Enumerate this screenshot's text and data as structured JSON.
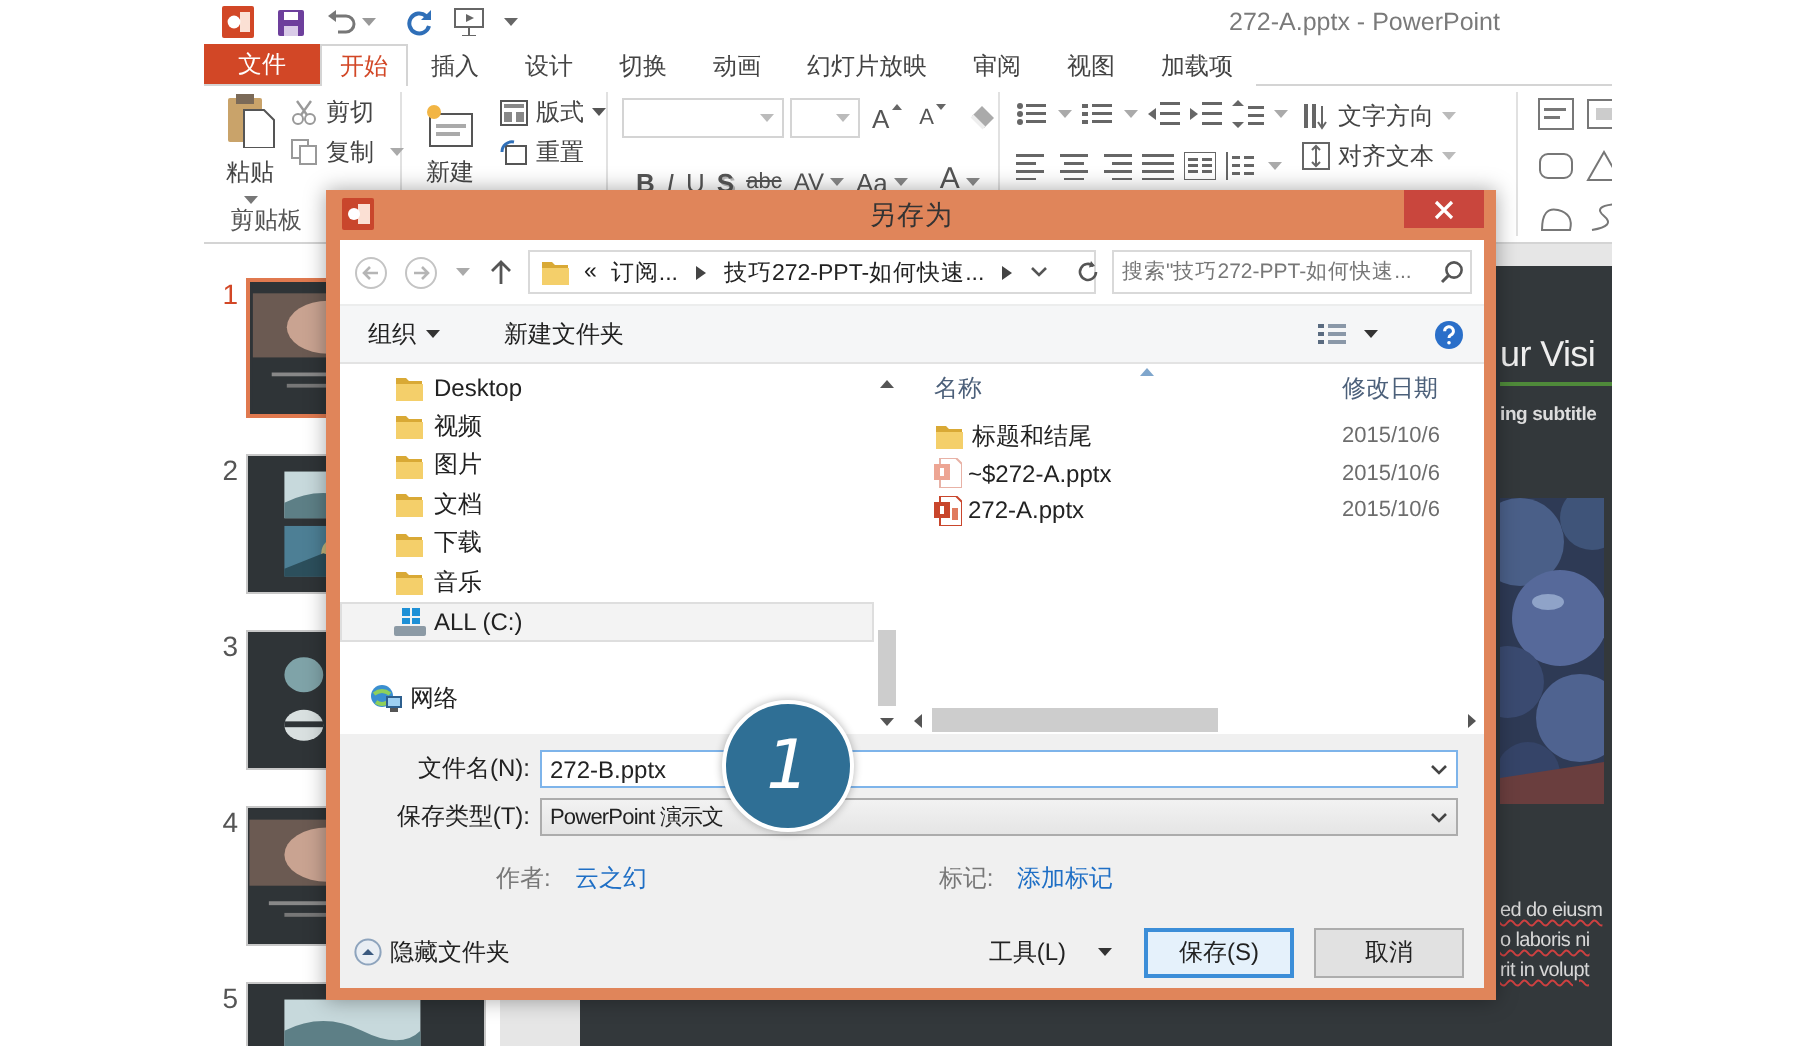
{
  "window": {
    "title": "272-A.pptx - PowerPoint"
  },
  "ribbon_tabs": [
    {
      "label": "文件",
      "kind": "file",
      "selected": false
    },
    {
      "label": "开始",
      "kind": "tab",
      "selected": true
    },
    {
      "label": "插入",
      "kind": "tab",
      "selected": false
    },
    {
      "label": "设计",
      "kind": "tab",
      "selected": false
    },
    {
      "label": "切换",
      "kind": "tab",
      "selected": false
    },
    {
      "label": "动画",
      "kind": "tab",
      "selected": false
    },
    {
      "label": "幻灯片放映",
      "kind": "tab",
      "selected": false
    },
    {
      "label": "审阅",
      "kind": "tab",
      "selected": false
    },
    {
      "label": "视图",
      "kind": "tab",
      "selected": false
    },
    {
      "label": "加载项",
      "kind": "tab",
      "selected": false
    }
  ],
  "ribbon": {
    "clipboard": {
      "paste": "粘贴",
      "cut": "剪切",
      "copy": "复制",
      "group_label": "剪贴板"
    },
    "slides": {
      "new_slide": "新建",
      "layout": "版式",
      "reset": "重置"
    },
    "font_size_buttons": [
      {
        "label": "A",
        "kind": "grow"
      },
      {
        "label": "A",
        "kind": "shrink"
      }
    ],
    "font_buttons": [
      {
        "label": "B",
        "kind": "bold"
      },
      {
        "label": "I",
        "kind": "italic"
      },
      {
        "label": "U",
        "kind": "underline"
      },
      {
        "label": "S",
        "kind": "shadow"
      },
      {
        "label": "abc",
        "kind": "strike"
      },
      {
        "label": "AV",
        "kind": "spacing"
      },
      {
        "label": "Aa",
        "kind": "case"
      },
      {
        "label": "A",
        "kind": "color"
      }
    ],
    "paragraph": {
      "text_direction": "文字方向",
      "align_text": "对齐文本"
    }
  },
  "slides": [
    {
      "number": "1",
      "selected": true
    },
    {
      "number": "2",
      "selected": false
    },
    {
      "number": "3",
      "selected": false
    },
    {
      "number": "4",
      "selected": false
    },
    {
      "number": "5",
      "selected": false
    }
  ],
  "slide": {
    "title": "ur Visi",
    "subtitle": "ing subtitle",
    "body_lines": [
      "ed do eiusm",
      "o laboris ni",
      "rit in volupt"
    ]
  },
  "dialog": {
    "title": "另存为",
    "address": {
      "overflow": "«",
      "segments": [
        "订阅...",
        "技巧272-PPT-如何快速..."
      ]
    },
    "search": {
      "placeholder": "搜索\"技巧272-PPT-如何快速..."
    },
    "toolbar": {
      "organize": "组织",
      "new_folder": "新建文件夹"
    },
    "nav_tree": [
      {
        "label": "Desktop",
        "kind": "folder",
        "selected": false
      },
      {
        "label": "视频",
        "kind": "folder",
        "selected": false
      },
      {
        "label": "图片",
        "kind": "folder",
        "selected": false
      },
      {
        "label": "文档",
        "kind": "folder",
        "selected": false
      },
      {
        "label": "下载",
        "kind": "folder",
        "selected": false
      },
      {
        "label": "音乐",
        "kind": "folder",
        "selected": false
      },
      {
        "label": "ALL (C:)",
        "kind": "drive",
        "selected": true
      },
      {
        "label": "网络",
        "kind": "network",
        "selected": false
      }
    ],
    "columns": [
      "名称",
      "修改日期"
    ],
    "files": [
      {
        "name": "标题和结尾",
        "kind": "folder",
        "date": "2015/10/6"
      },
      {
        "name": "~$272-A.pptx",
        "kind": "temp",
        "date": "2015/10/6"
      },
      {
        "name": "272-A.pptx",
        "kind": "pptx",
        "date": "2015/10/6"
      }
    ],
    "file_name": {
      "label": "文件名(N):",
      "value": "272-B.pptx"
    },
    "file_type": {
      "label": "保存类型(T):",
      "value": "PowerPoint 演示文"
    },
    "author": {
      "label": "作者:",
      "value": "云之幻"
    },
    "tags": {
      "label": "标记:",
      "value": "添加标记"
    },
    "hide_folders": "隐藏文件夹",
    "tools": "工具(L)",
    "buttons": [
      {
        "label": "保存(S)",
        "kind": "primary"
      },
      {
        "label": "取消",
        "kind": "normal"
      }
    ]
  },
  "callout": {
    "number": "1"
  }
}
